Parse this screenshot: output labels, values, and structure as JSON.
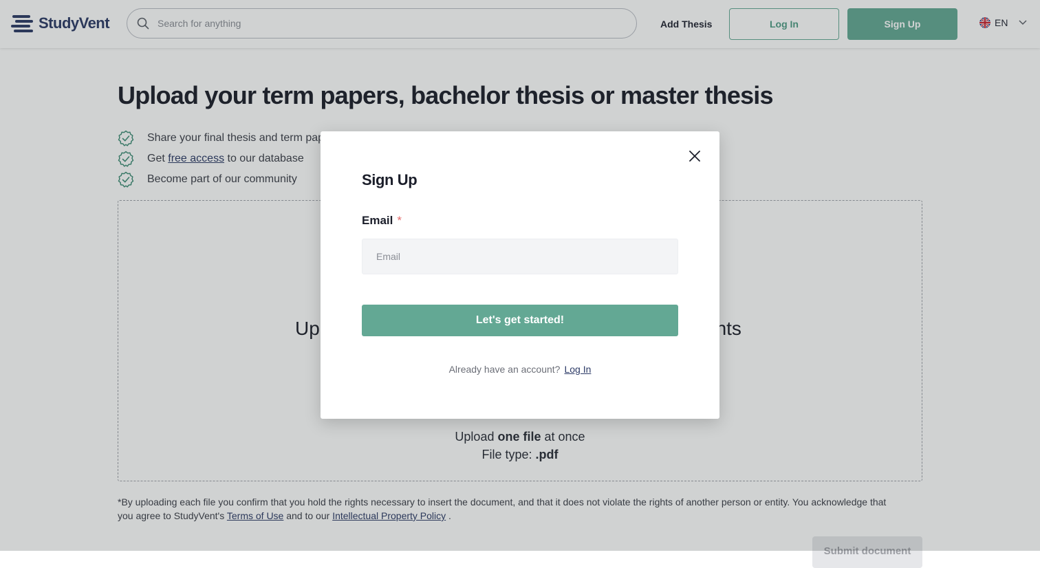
{
  "header": {
    "brand": "StudyVent",
    "search_placeholder": "Search for anything",
    "add_thesis": "Add Thesis",
    "login": "Log In",
    "signup": "Sign Up",
    "language": "EN"
  },
  "page": {
    "title": "Upload your term papers, bachelor thesis or master thesis",
    "benefits": {
      "b1": "Share your final thesis and term papers",
      "b2_pre": "Get",
      "b2_link": "free access",
      "b2_post": "to our database",
      "b3": "Become part of our community"
    },
    "dropzone": {
      "title_left": "Upl",
      "title_right": "ents",
      "line1_pre": "Upload",
      "line1_bold": "one file",
      "line1_post": "at once",
      "line2_pre": "File type:",
      "line2_bold": ".pdf"
    },
    "legal": {
      "text1": "*By uploading each file you confirm that you hold the rights necessary to insert the document, and that it does not violate the rights of another person or entity. You acknowledge that you agree to StudyVent's",
      "terms": "Terms of Use",
      "and": "and to our",
      "ip_policy": "Intellectual Property Policy",
      "end": "."
    },
    "submit": "Submit document"
  },
  "modal": {
    "title": "Sign Up",
    "email_label": "Email",
    "required_mark": "*",
    "email_placeholder": "Email",
    "cta": "Let's get started!",
    "already": "Already have an account?",
    "login_link": "Log In"
  },
  "colors": {
    "accent": "#63a894",
    "brand_navy": "#2c3a66",
    "required": "#e36b6b"
  },
  "icons": [
    "logo-icon",
    "search-icon",
    "uk-flag-icon",
    "chevron-down-icon",
    "check-badge-icon",
    "close-icon"
  ]
}
